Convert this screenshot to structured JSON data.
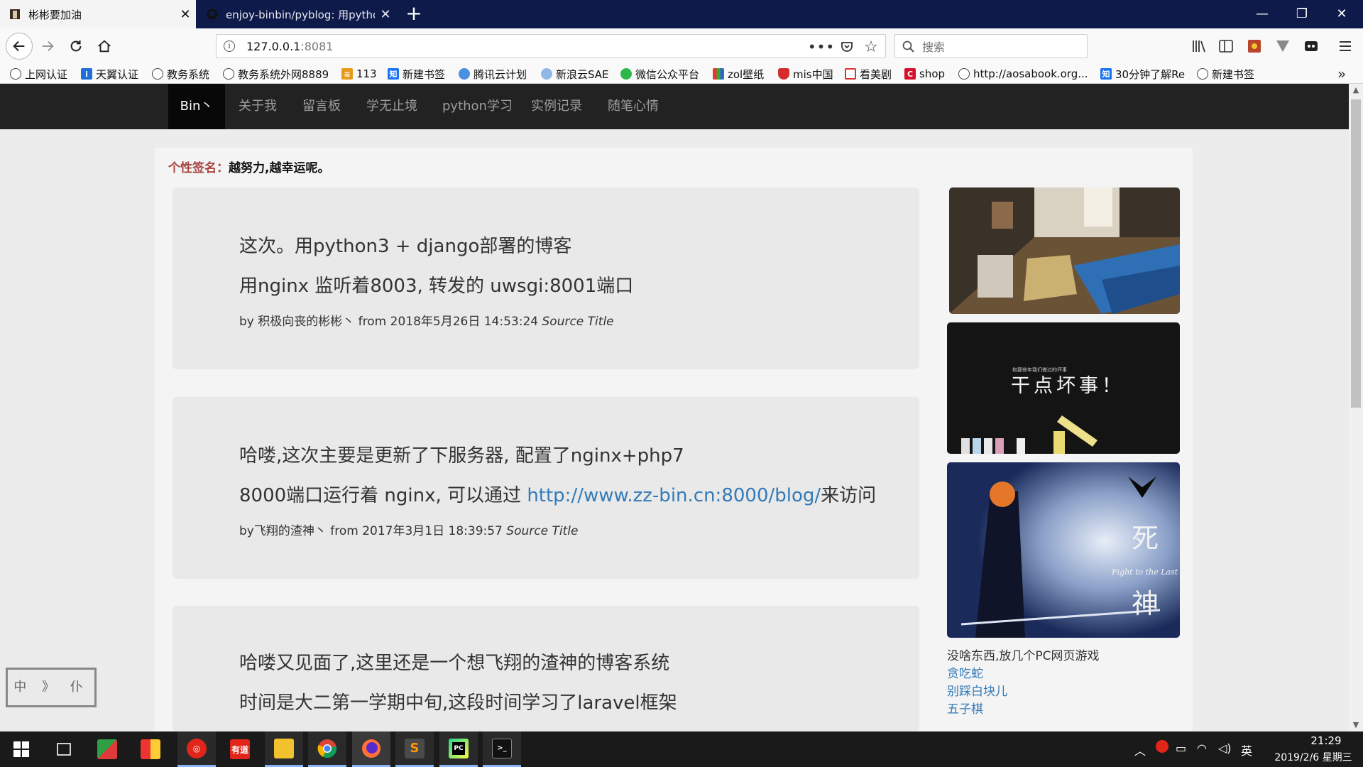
{
  "browser": {
    "tabs": [
      {
        "title": "彬彬要加油",
        "active": true
      },
      {
        "title": "enjoy-binbin/pyblog: 用python",
        "active": false
      }
    ],
    "url_host": "127.0.0.1",
    "url_port": ":8081",
    "search_placeholder": "搜索",
    "bookmarks": [
      {
        "label": "上网认证",
        "icon": "globe-icon"
      },
      {
        "label": "天翼认证",
        "icon": "tianyi-icon"
      },
      {
        "label": "教务系统",
        "icon": "globe-icon"
      },
      {
        "label": "教务系统外网8889",
        "icon": "globe-icon"
      },
      {
        "label": "113",
        "icon": "stack-icon"
      },
      {
        "label": "新建书签",
        "icon": "zhihu-icon"
      },
      {
        "label": "腾讯云计划",
        "icon": "cloud-icon"
      },
      {
        "label": "新浪云SAE",
        "icon": "cloud-icon"
      },
      {
        "label": "微信公众平台",
        "icon": "wechat-icon"
      },
      {
        "label": "zol壁纸",
        "icon": "zol-icon"
      },
      {
        "label": "mis中国",
        "icon": "shield-icon"
      },
      {
        "label": "看美剧",
        "icon": "tv-icon"
      },
      {
        "label": "shop",
        "icon": "c-icon"
      },
      {
        "label": "http://aosabook.org...",
        "icon": "globe-icon"
      },
      {
        "label": "30分钟了解Re",
        "icon": "zhihu-icon"
      },
      {
        "label": "新建书签",
        "icon": "globe-icon"
      }
    ]
  },
  "site": {
    "brand": "Bin丶",
    "nav": [
      "关于我",
      "留言板",
      "学无止境",
      "python学习",
      "实例记录",
      "随笔心情"
    ],
    "signature_label": "个性签名：",
    "signature_text": "越努力,越幸运呢。"
  },
  "posts": [
    {
      "line1": "这次。用python3 + django部署的博客",
      "line2": "用nginx 监听着8003, 转发的 uwsgi:8001端口",
      "meta": "by 积极向丧的彬彬丶  from 2018年5月26日 14:53:24 ",
      "source": "Source Title"
    },
    {
      "line1": "哈喽,这次主要是更新了下服务器, 配置了nginx+php7",
      "line2_prefix": "8000端口运行着 nginx, 可以通过 ",
      "line2_link": "http://www.zz-bin.cn:8000/blog/",
      "line2_suffix": "来访问",
      "meta": "by飞翔的渣神丶  from 2017年3月1日 18:39:57 ",
      "source": "Source Title"
    },
    {
      "line1": "哈喽又见面了,这里还是一个想飞翔的渣神的博客系统",
      "line2": "时间是大二第一学期中旬,这段时间学习了laravel框架"
    }
  ],
  "sidebar": {
    "chalk_text": "干点坏事！",
    "chalk_small": "和那些年我们做过的坏事",
    "anime_kanji_1": "死",
    "anime_kanji_2": "神",
    "anime_caption": "Fight to the Last",
    "caption": "没啥东西,放几个PC网页游戏",
    "games": [
      "贪吃蛇",
      "别踩白块儿",
      "五子棋"
    ]
  },
  "stamp_text": "中 》 仆",
  "taskbar": {
    "apps": [
      "start",
      "task-view",
      "app-red-green",
      "app-grid",
      "netease-music",
      "youdao",
      "file-explorer",
      "chrome",
      "firefox",
      "sublime",
      "pycharm",
      "terminal"
    ],
    "ime": "英",
    "time": "21:29",
    "date": "2019/2/6 星期三"
  }
}
